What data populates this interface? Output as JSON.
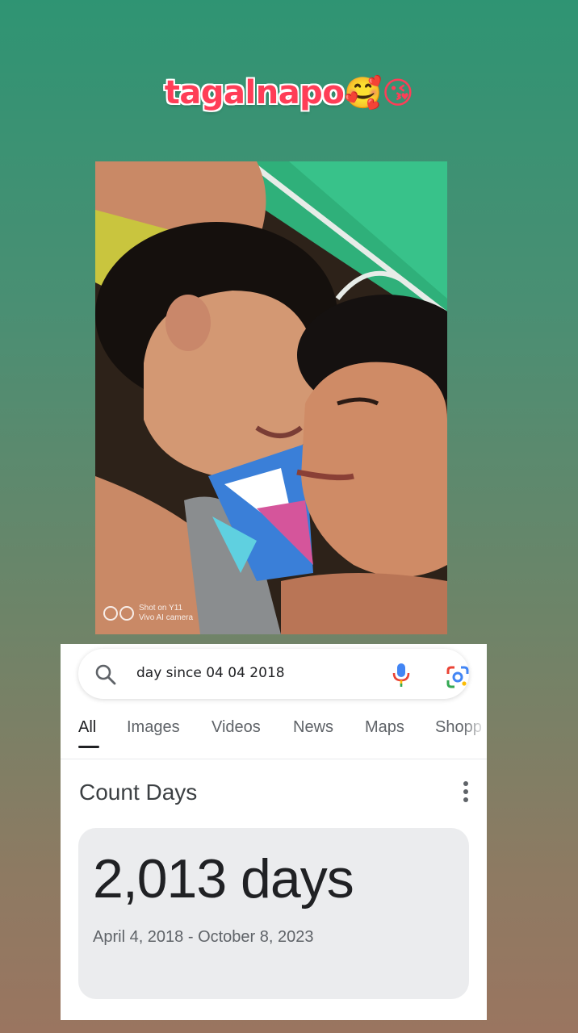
{
  "caption": {
    "text": "tagalnapo",
    "emojis": "🥰😘"
  },
  "photo": {
    "watermark_line1": "Shot on Y11",
    "watermark_line2": "Vivo AI camera"
  },
  "search": {
    "query": "day since 04 04 2018",
    "icons": [
      "search-icon",
      "mic-icon",
      "lens-icon"
    ]
  },
  "tabs": [
    {
      "label": "All",
      "active": true
    },
    {
      "label": "Images"
    },
    {
      "label": "Videos"
    },
    {
      "label": "News"
    },
    {
      "label": "Maps"
    },
    {
      "label": "Shopp"
    }
  ],
  "result": {
    "title": "Count Days",
    "value": "2,013 days",
    "range": "April 4, 2018 - October 8, 2023"
  },
  "colors": {
    "caption_red": "#ff3d57",
    "google_blue": "#4285f4",
    "google_red": "#ea4335",
    "google_yellow": "#fbbc05",
    "google_green": "#34a853"
  }
}
